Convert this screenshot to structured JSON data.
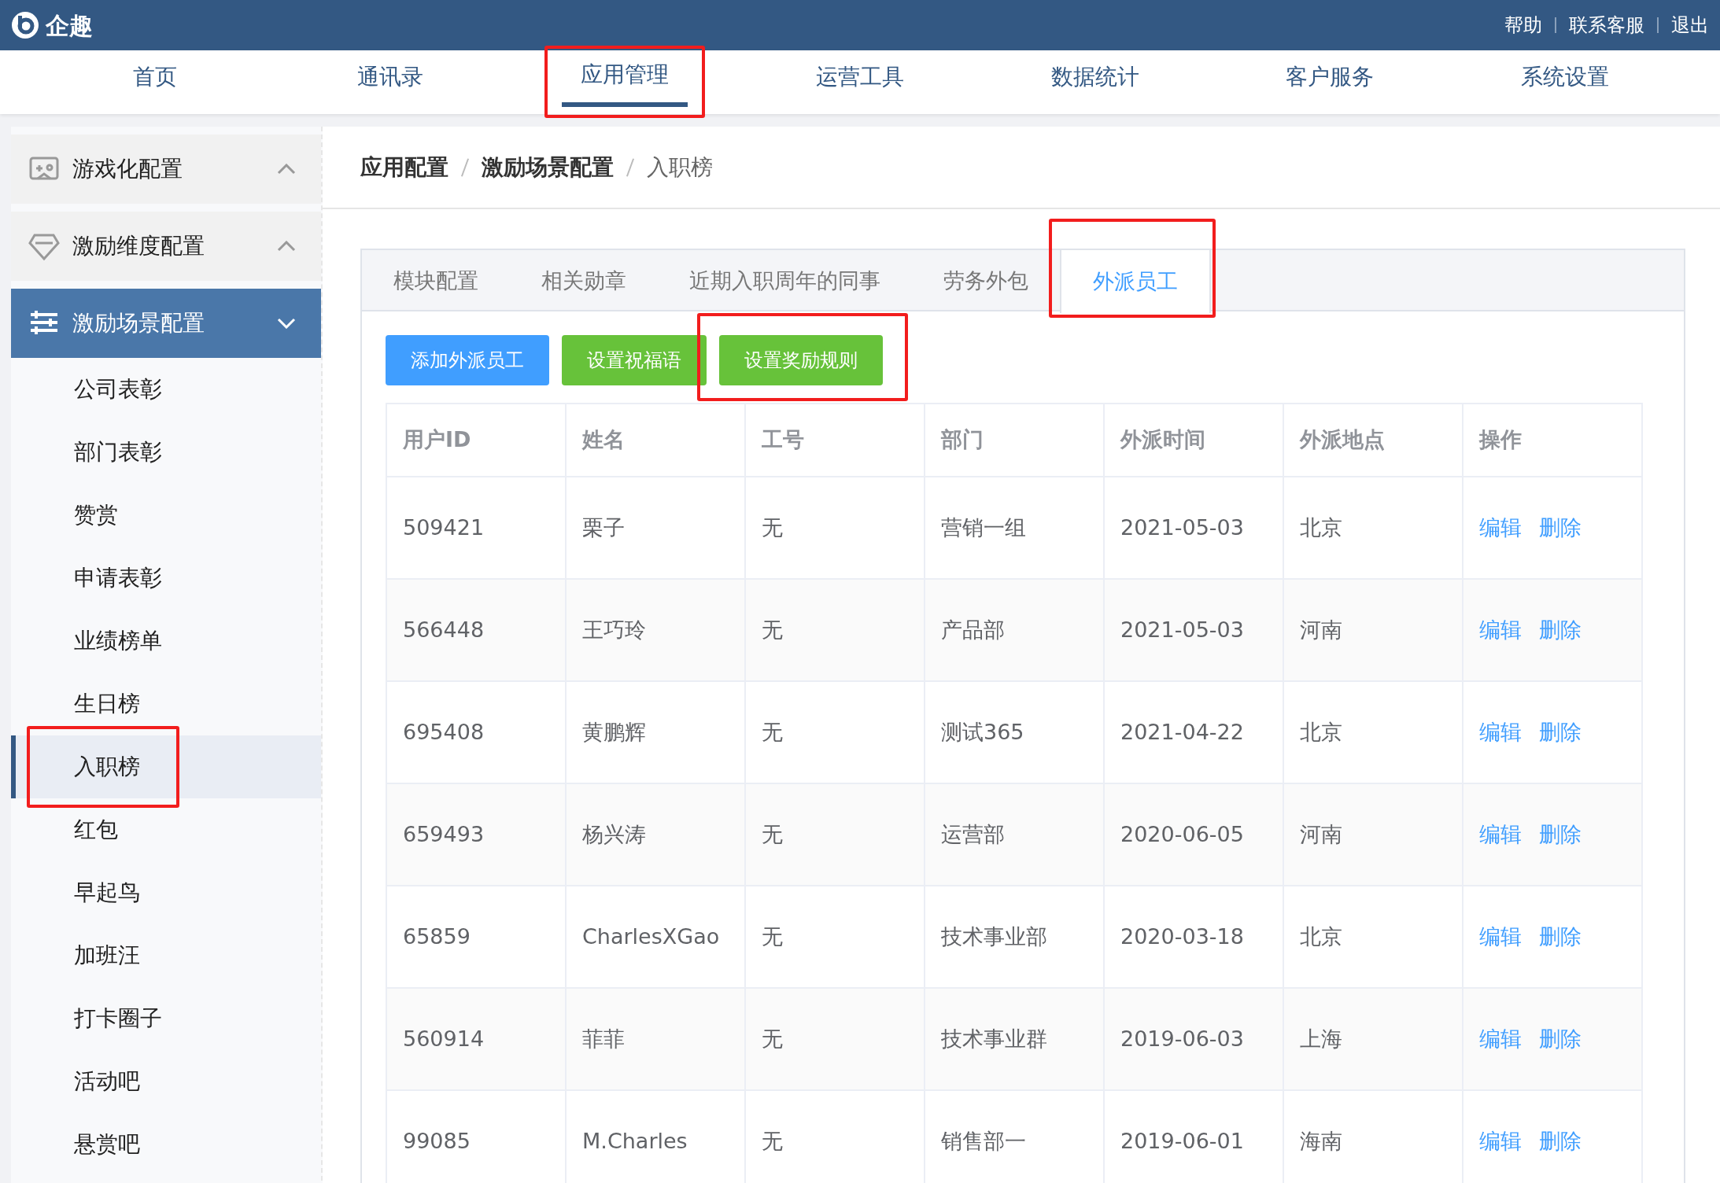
{
  "header": {
    "brand": "企趣",
    "links": [
      "帮助",
      "联系客服",
      "退出"
    ]
  },
  "nav": [
    {
      "label": "首页",
      "selected": false,
      "highlighted": false
    },
    {
      "label": "通讯录",
      "selected": false,
      "highlighted": false
    },
    {
      "label": "应用管理",
      "selected": true,
      "highlighted": true
    },
    {
      "label": "运营工具",
      "selected": false,
      "highlighted": false
    },
    {
      "label": "数据统计",
      "selected": false,
      "highlighted": false
    },
    {
      "label": "客户服务",
      "selected": false,
      "highlighted": false
    },
    {
      "label": "系统设置",
      "selected": false,
      "highlighted": false
    }
  ],
  "sidebar": {
    "groups": [
      {
        "label": "游戏化配置",
        "kind": "gamepad",
        "expanded": false,
        "selected": false
      },
      {
        "label": "激励维度配置",
        "kind": "diamond",
        "expanded": false,
        "selected": false
      },
      {
        "label": "激励场景配置",
        "kind": "sliders",
        "expanded": true,
        "selected": true,
        "children": [
          {
            "label": "公司表彰",
            "selected": false,
            "highlighted": false
          },
          {
            "label": "部门表彰",
            "selected": false,
            "highlighted": false
          },
          {
            "label": "赞赏",
            "selected": false,
            "highlighted": false
          },
          {
            "label": "申请表彰",
            "selected": false,
            "highlighted": false
          },
          {
            "label": "业绩榜单",
            "selected": false,
            "highlighted": false
          },
          {
            "label": "生日榜",
            "selected": false,
            "highlighted": false
          },
          {
            "label": "入职榜",
            "selected": true,
            "highlighted": true
          },
          {
            "label": "红包",
            "selected": false,
            "highlighted": false
          },
          {
            "label": "早起鸟",
            "selected": false,
            "highlighted": false
          },
          {
            "label": "加班汪",
            "selected": false,
            "highlighted": false
          },
          {
            "label": "打卡圈子",
            "selected": false,
            "highlighted": false
          },
          {
            "label": "活动吧",
            "selected": false,
            "highlighted": false
          },
          {
            "label": "悬赏吧",
            "selected": false,
            "highlighted": false
          }
        ]
      }
    ]
  },
  "breadcrumb": [
    "应用配置",
    "激励场景配置",
    "入职榜"
  ],
  "tabs": [
    {
      "label": "模块配置",
      "selected": false,
      "highlighted": false
    },
    {
      "label": "相关勋章",
      "selected": false,
      "highlighted": false
    },
    {
      "label": "近期入职周年的同事",
      "selected": false,
      "highlighted": false
    },
    {
      "label": "劳务外包",
      "selected": false,
      "highlighted": false
    },
    {
      "label": "外派员工",
      "selected": true,
      "highlighted": true
    }
  ],
  "buttons": [
    {
      "label": "添加外派员工",
      "kind": "primary",
      "highlighted": false
    },
    {
      "label": "设置祝福语",
      "kind": "success",
      "highlighted": false
    },
    {
      "label": "设置奖励规则",
      "kind": "success",
      "highlighted": true
    }
  ],
  "table": {
    "columns": [
      "用户ID",
      "姓名",
      "工号",
      "部门",
      "外派时间",
      "外派地点",
      "操作"
    ],
    "rows": [
      {
        "cells": [
          "509421",
          "栗子",
          "无",
          "营销一组",
          "2021-05-03",
          "北京"
        ],
        "actions": [
          "编辑",
          "删除"
        ]
      },
      {
        "cells": [
          "566448",
          "王巧玲",
          "无",
          "产品部",
          "2021-05-03",
          "河南"
        ],
        "actions": [
          "编辑",
          "删除"
        ]
      },
      {
        "cells": [
          "695408",
          "黄鹏辉",
          "无",
          "测试365",
          "2021-04-22",
          "北京"
        ],
        "actions": [
          "编辑",
          "删除"
        ]
      },
      {
        "cells": [
          "659493",
          "杨兴涛",
          "无",
          "运营部",
          "2020-06-05",
          "河南"
        ],
        "actions": [
          "编辑",
          "删除"
        ]
      },
      {
        "cells": [
          "65859",
          "CharlesXGao",
          "无",
          "技术事业部",
          "2020-03-18",
          "北京"
        ],
        "actions": [
          "编辑",
          "删除"
        ]
      },
      {
        "cells": [
          "560914",
          "菲菲",
          "无",
          "技术事业群",
          "2019-06-03",
          "上海"
        ],
        "actions": [
          "编辑",
          "删除"
        ]
      },
      {
        "cells": [
          "99085",
          "M.Charles",
          "无",
          "销售部一",
          "2019-06-01",
          "海南"
        ],
        "actions": [
          "编辑",
          "删除"
        ]
      }
    ]
  }
}
